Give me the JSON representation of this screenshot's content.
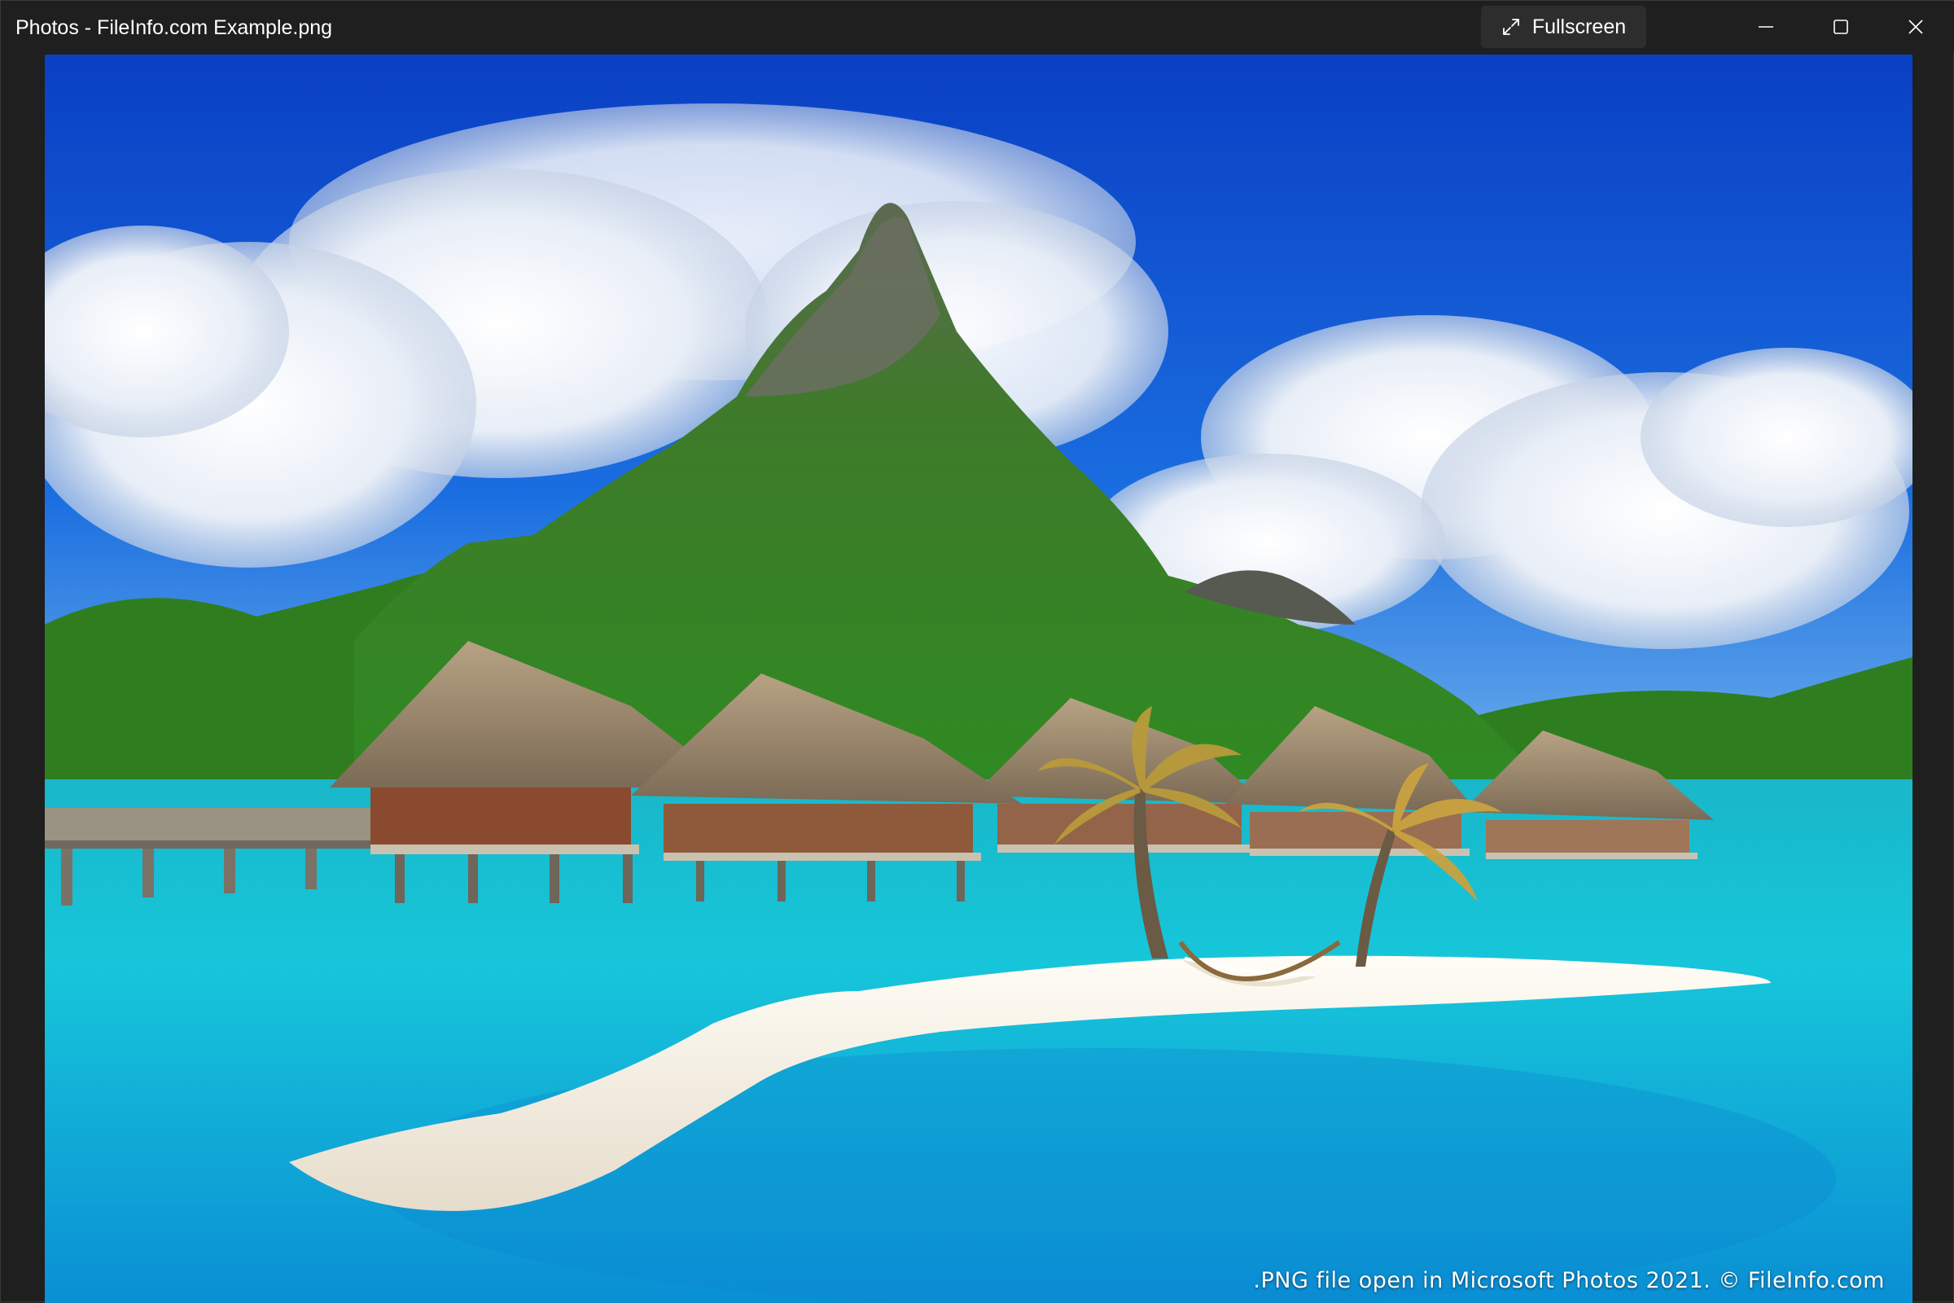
{
  "window": {
    "title": "Photos - FileInfo.com Example.png"
  },
  "toolbar": {
    "fullscreen_label": "Fullscreen",
    "fullscreen_icon": "expand-diagonal-icon"
  },
  "window_controls": {
    "minimize_icon": "minimize-icon",
    "maximize_icon": "maximize-icon",
    "close_icon": "close-icon"
  },
  "image": {
    "caption": ".PNG file open in Microsoft Photos 2021. © FileInfo.com",
    "subject": "tropical-overwater-bungalows-photo"
  },
  "colors": {
    "titlebar_bg": "#1f1f1f",
    "button_bg": "#2d2d2d",
    "text": "#ffffff"
  }
}
